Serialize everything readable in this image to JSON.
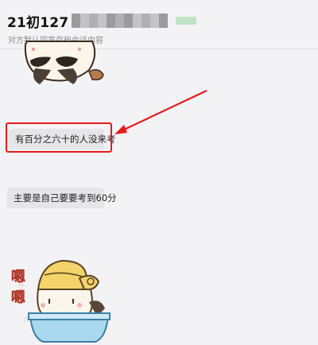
{
  "header": {
    "title": "21初127",
    "subtitle": "对方默认同意存档会话内容"
  },
  "messages": [
    {
      "text": "有百分之六十的人没来考",
      "highlighted": true
    },
    {
      "text": "主要是自己要要考到60分",
      "highlighted": false
    }
  ],
  "stickers": [
    {
      "icon": "panda-mustache-sticker-icon"
    },
    {
      "icon": "bathing-bunny-sticker-icon",
      "caption": "嗯嗯"
    }
  ],
  "colors": {
    "highlight": "#e31b1b",
    "bubble": "#e6e6e9",
    "background": "#f3f3f5"
  }
}
